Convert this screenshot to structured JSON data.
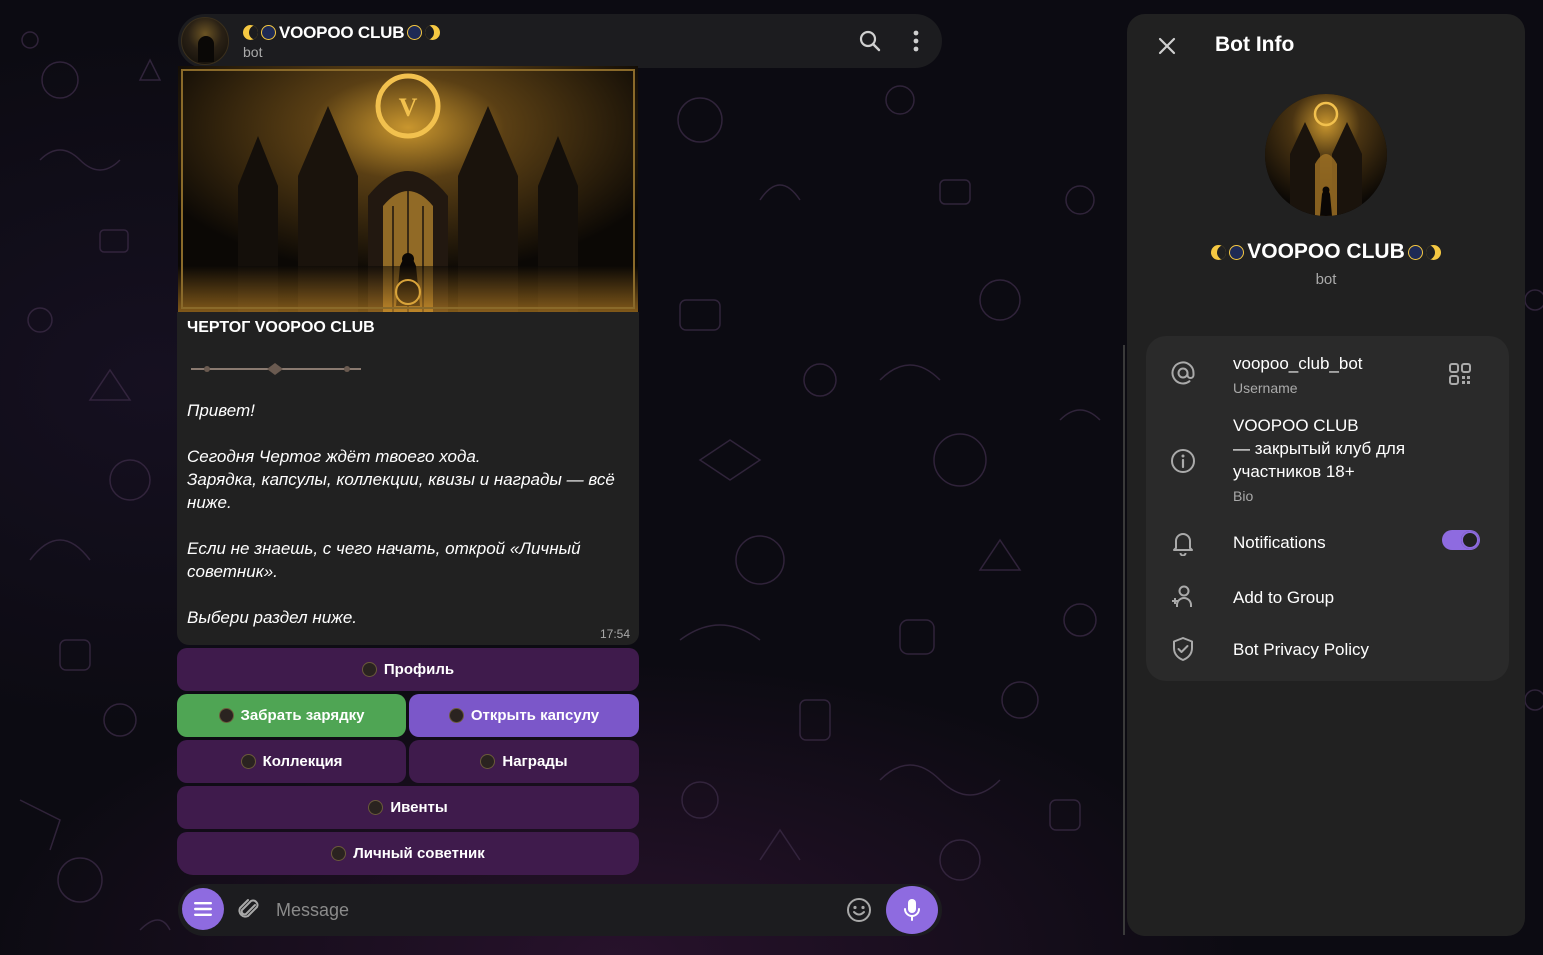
{
  "chat": {
    "title": "VOOPOO CLUB",
    "subtitle": "bot"
  },
  "message": {
    "heading": "ЧЕРТОГ VOOPOO CLUB",
    "paragraphs": [
      "Привет!",
      "Сегодня Чертог ждёт твоего хода.",
      "Зарядка, капсулы, коллекции, квизы и награды — всё ниже.",
      "Если не знаешь, с чего начать, открой «Личный советник».",
      "Выбери раздел ниже."
    ],
    "time": "17:54"
  },
  "keyboard": {
    "profile": "Профиль",
    "charge": "Забрать зарядку",
    "capsule": "Открыть капсулу",
    "collection": "Коллекция",
    "rewards": "Награды",
    "events": "Ивенты",
    "advisor": "Личный советник"
  },
  "composer": {
    "placeholder": "Message"
  },
  "panel": {
    "title": "Bot Info",
    "name": "VOOPOO CLUB",
    "subtitle": "bot",
    "username": "voopoo_club_bot",
    "username_label": "Username",
    "bio_line1": "VOOPOO CLUB",
    "bio_line2": "— закрытый клуб для",
    "bio_line3": "участников 18+",
    "bio_label": "Bio",
    "notifications": "Notifications",
    "notifications_on": true,
    "add_to_group": "Add to Group",
    "privacy": "Bot Privacy Policy"
  },
  "colors": {
    "accent": "#8e6be0",
    "button_purple": "#3f1b4c",
    "button_green": "#4fa554",
    "button_violet": "#7b57c9",
    "panel_bg": "#212121"
  }
}
